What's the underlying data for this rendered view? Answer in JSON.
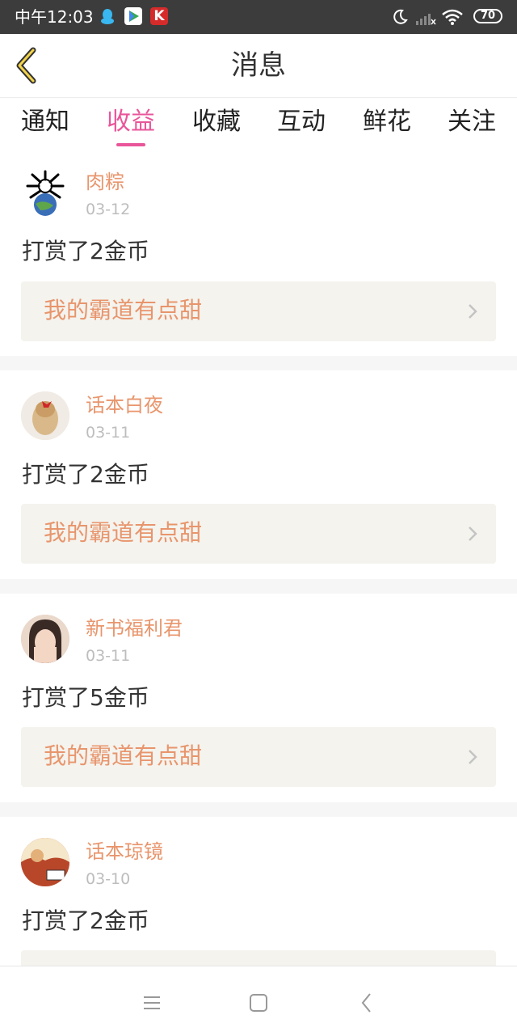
{
  "status_bar": {
    "time": "中午12:03",
    "battery": "70",
    "apps": [
      "qq-icon",
      "play-store-icon",
      "k-app-icon"
    ],
    "k_app_letter": "K"
  },
  "header": {
    "title": "消息"
  },
  "tabs": [
    {
      "label": "通知",
      "active": false
    },
    {
      "label": "收益",
      "active": true
    },
    {
      "label": "收藏",
      "active": false
    },
    {
      "label": "互动",
      "active": false
    },
    {
      "label": "鲜花",
      "active": false
    },
    {
      "label": "关注",
      "active": false
    }
  ],
  "messages": [
    {
      "name": "肉粽",
      "date": "03-12",
      "text": "打赏了2金币",
      "book": "我的霸道有点甜"
    },
    {
      "name": "话本白夜",
      "date": "03-11",
      "text": "打赏了2金币",
      "book": "我的霸道有点甜"
    },
    {
      "name": "新书福利君",
      "date": "03-11",
      "text": "打赏了5金币",
      "book": "我的霸道有点甜"
    },
    {
      "name": "话本琼镜",
      "date": "03-10",
      "text": "打赏了2金币",
      "book": ""
    }
  ],
  "colors": {
    "accent_pink": "#e9559a",
    "name_orange": "#e8956c",
    "status_bar": "#3c3c3c",
    "book_box_bg": "#f4f3ee"
  }
}
